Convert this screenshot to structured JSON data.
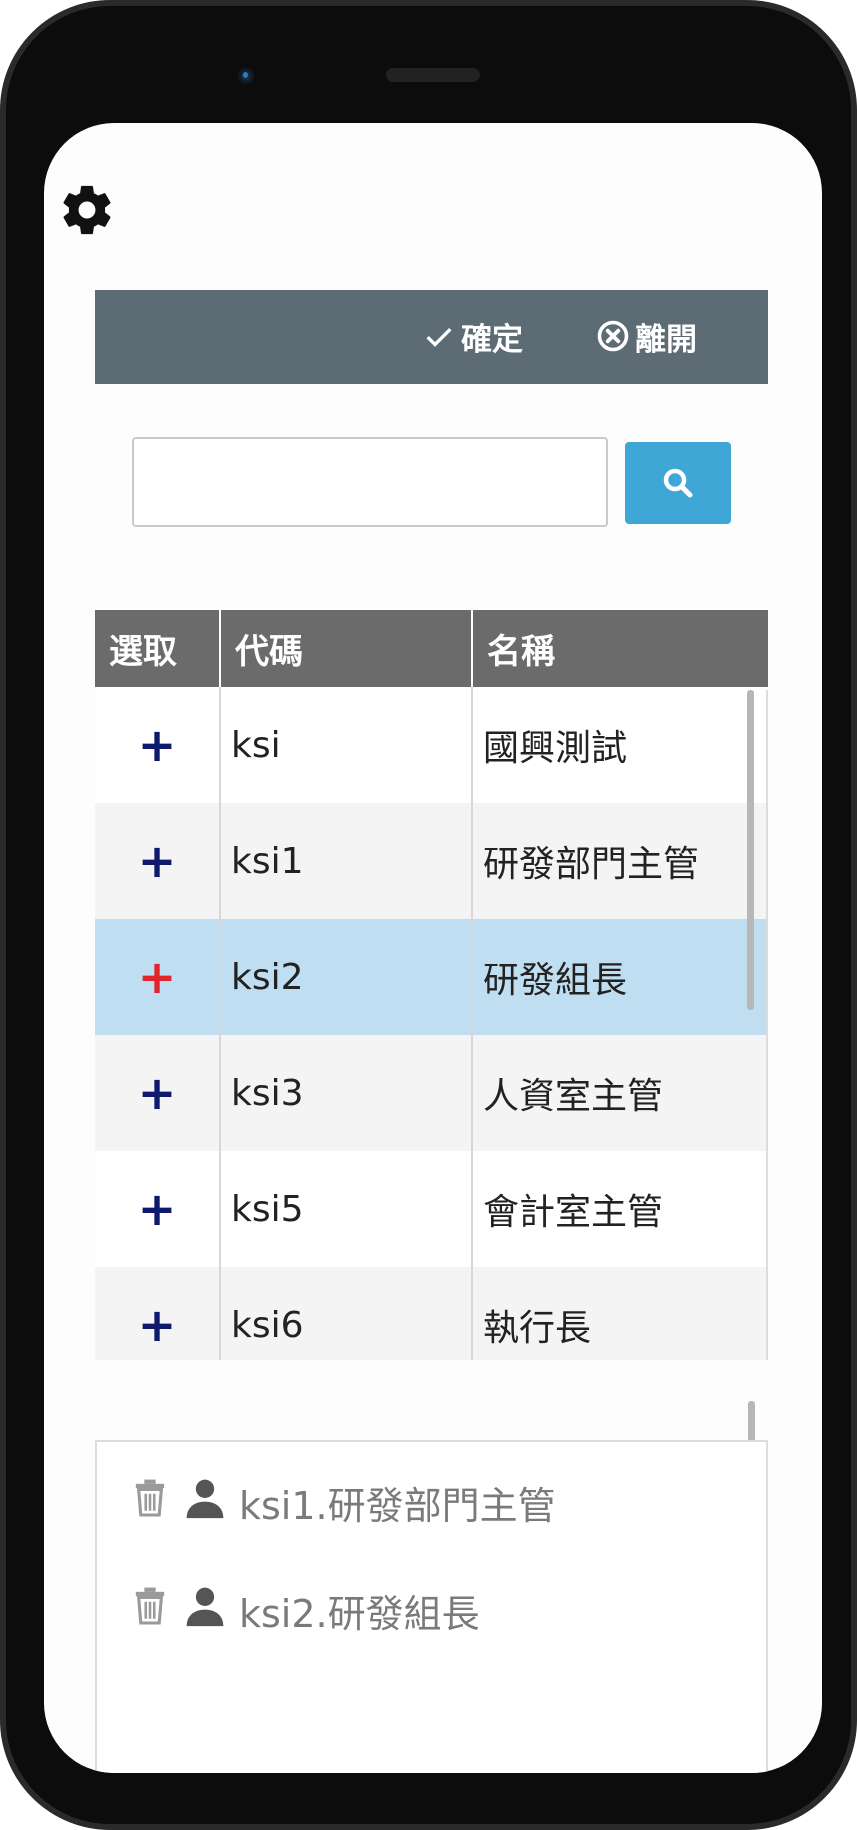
{
  "toolbar": {
    "confirm_label": "確定",
    "leave_label": "離開"
  },
  "search": {
    "value": "",
    "placeholder": ""
  },
  "table": {
    "headers": [
      "選取",
      "代碼",
      "名稱"
    ],
    "rows": [
      {
        "code": "ksi",
        "name": "國興測試"
      },
      {
        "code": "ksi1",
        "name": "研發部門主管"
      },
      {
        "code": "ksi2",
        "name": "研發組長"
      },
      {
        "code": "ksi3",
        "name": "人資室主管"
      },
      {
        "code": "ksi5",
        "name": "會計室主管"
      },
      {
        "code": "ksi6",
        "name": "執行長"
      }
    ],
    "add_symbol": "+"
  },
  "selected": [
    {
      "label": "ksi1.研發部門主管"
    },
    {
      "label": "ksi2.研發組長"
    }
  ],
  "colors": {
    "toolbar_bg": "#5d6b74",
    "search_button": "#3fa7d6",
    "header_bg": "#6b6b6b",
    "selected_row": "#bfdef1",
    "add_icon": "#0f1a6e",
    "add_icon_selected": "#e0262b"
  },
  "icons": {
    "settings": "gear-icon",
    "confirm": "check-icon",
    "leave": "close-circle-icon",
    "search": "search-icon",
    "remove": "trash-icon",
    "user": "person-icon"
  }
}
